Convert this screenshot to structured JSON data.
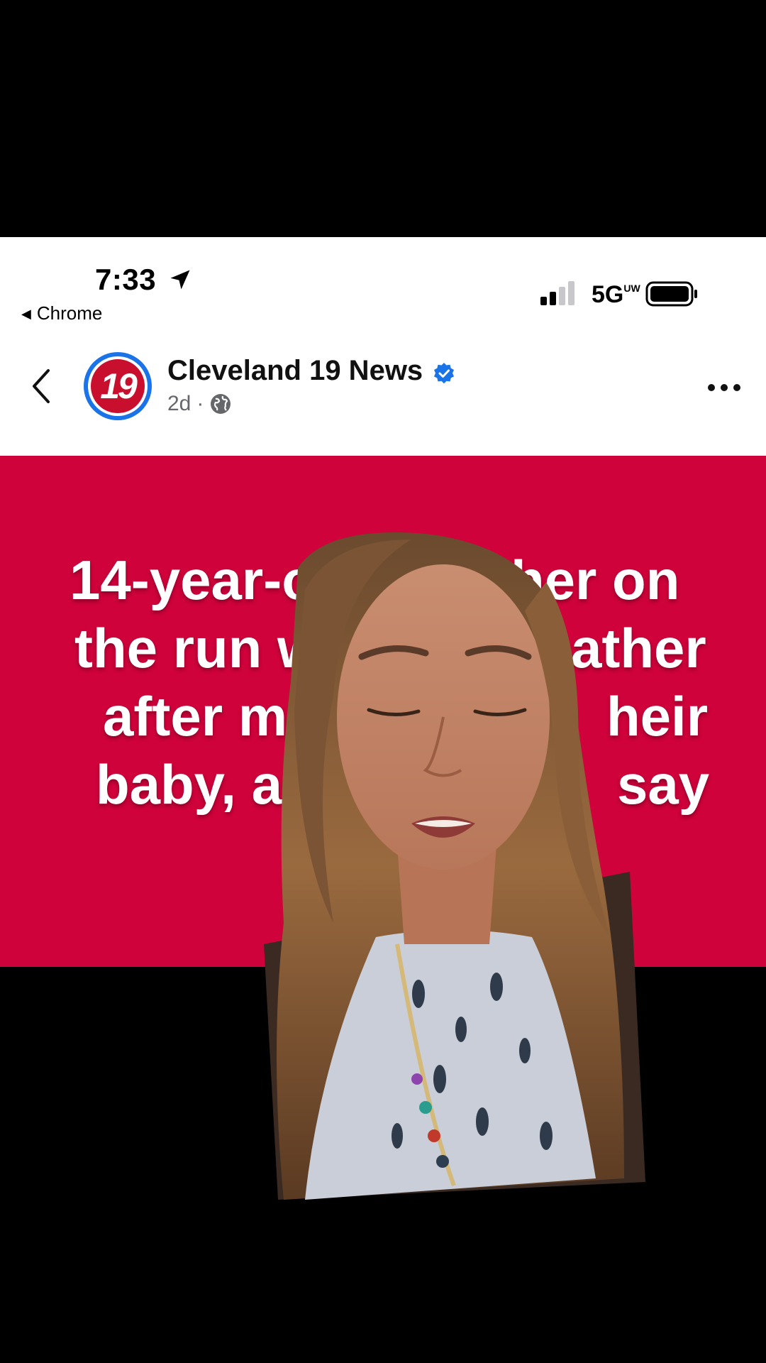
{
  "status_bar": {
    "time": "7:33",
    "back_app": "Chrome",
    "network": "5G",
    "network_super": "UW"
  },
  "post_header": {
    "page_name": "Cleveland 19 News",
    "avatar_text": "19",
    "age": "2d",
    "separator": "·"
  },
  "video": {
    "headline": "14-year-old mother on the run with baby's father after murdering their baby, authorities say",
    "visible_headline_lines": [
      "14-year-ol",
      "her on",
      "the run w",
      "ather",
      "after m",
      "heir",
      "baby, a",
      "say"
    ],
    "background_color": "#d0023b"
  },
  "colors": {
    "accent_blue": "#1a73e8",
    "brand_red": "#c8102e"
  }
}
